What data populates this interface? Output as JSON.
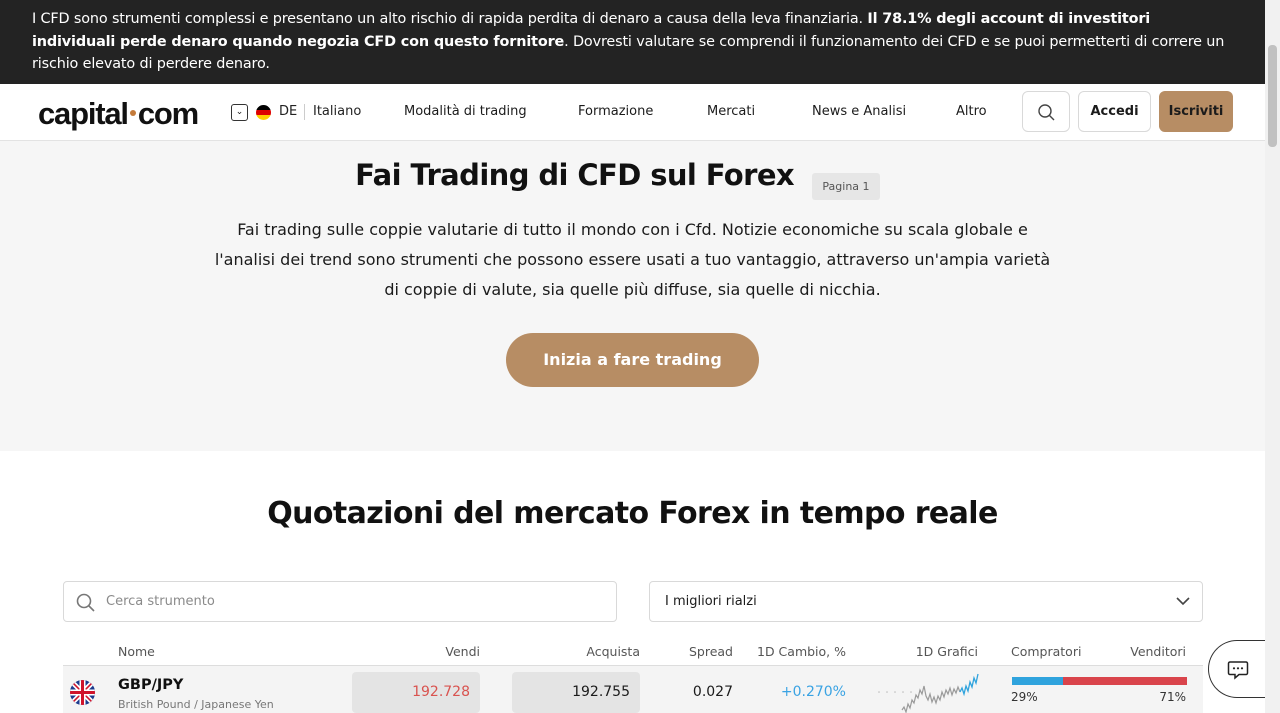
{
  "risk": {
    "part1": "I CFD sono strumenti complessi e presentano un alto rischio di rapida perdita di denaro a causa della leva finanziaria. ",
    "bold": "Il 78.1% degli account di investitori individuali perde denaro quando negozia CFD con questo fornitore",
    "part2": ". Dovresti valutare se comprendi il funzionamento dei CFD e se puoi permetterti di correre un rischio elevato di perdere denaro."
  },
  "header": {
    "logo_a": "capital",
    "logo_b": "com",
    "country": "DE",
    "language": "Italiano",
    "nav": [
      "Modalità di trading",
      "Formazione",
      "Mercati",
      "News e Analisi",
      "Altro"
    ],
    "login": "Accedi",
    "signup": "Iscriviti"
  },
  "hero": {
    "title": "Fai Trading di CFD sul Forex",
    "page_badge": "Pagina 1",
    "description": "Fai trading sulle coppie valutarie di tutto il mondo con i Cfd. Notizie economiche su scala globale e l'analisi dei trend sono strumenti che possono essere usati a tuo vantaggio, attraverso un'ampia varietà di coppie di valute, sia quelle più diffuse, sia quelle di nicchia.",
    "cta": "Inizia a fare trading"
  },
  "market": {
    "title": "Quotazioni del mercato Forex in tempo reale",
    "search_placeholder": "Cerca strumento",
    "sort_selected": "I migliori rialzi",
    "columns": {
      "name": "Nome",
      "sell": "Vendi",
      "buy": "Acquista",
      "spread": "Spread",
      "change": "1D Cambio, %",
      "chart": "1D Grafici",
      "buyers": "Compratori",
      "sellers": "Venditori"
    },
    "rows": [
      {
        "symbol": "GBP/JPY",
        "name": "British Pound / Japanese Yen",
        "sell": "192.728",
        "buy": "192.755",
        "spread": "0.027",
        "change": "+0.270%",
        "buyers_pct": "29%",
        "sellers_pct": "71%",
        "buyers_fraction": 0.29
      }
    ]
  },
  "colors": {
    "brand": "#b78d64",
    "banner": "#232323",
    "sell_price": "#d9534f",
    "positive": "#3aa3e3",
    "buyers_bar": "#2fa3dd",
    "sellers_bar": "#d9444b"
  },
  "icons": [
    "chevron-down-icon",
    "germany-flag-icon",
    "search-icon",
    "uk-flag-icon",
    "chat-icon"
  ]
}
